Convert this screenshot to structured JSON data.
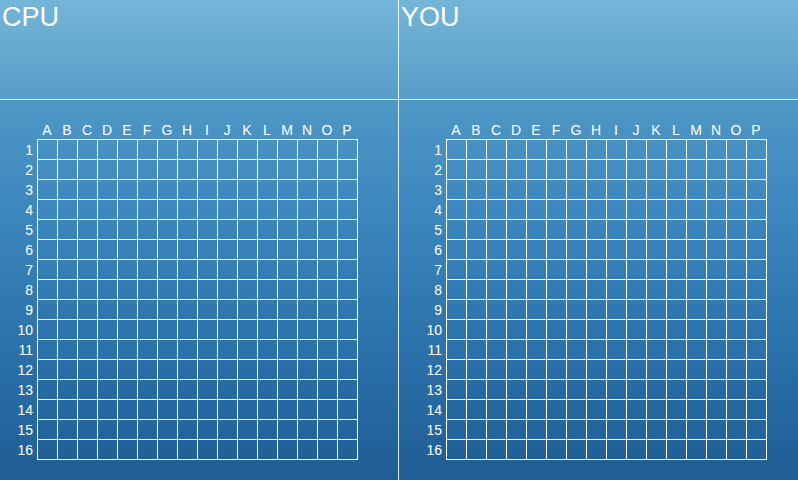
{
  "panels": [
    {
      "title": "CPU",
      "columns": [
        "A",
        "B",
        "C",
        "D",
        "E",
        "F",
        "G",
        "H",
        "I",
        "J",
        "K",
        "L",
        "M",
        "N",
        "O",
        "P"
      ],
      "rows": [
        "1",
        "2",
        "3",
        "4",
        "5",
        "6",
        "7",
        "8",
        "9",
        "10",
        "11",
        "12",
        "13",
        "14",
        "15",
        "16"
      ]
    },
    {
      "title": "YOU",
      "columns": [
        "A",
        "B",
        "C",
        "D",
        "E",
        "F",
        "G",
        "H",
        "I",
        "J",
        "K",
        "L",
        "M",
        "N",
        "O",
        "P"
      ],
      "rows": [
        "1",
        "2",
        "3",
        "4",
        "5",
        "6",
        "7",
        "8",
        "9",
        "10",
        "11",
        "12",
        "13",
        "14",
        "15",
        "16"
      ]
    }
  ]
}
